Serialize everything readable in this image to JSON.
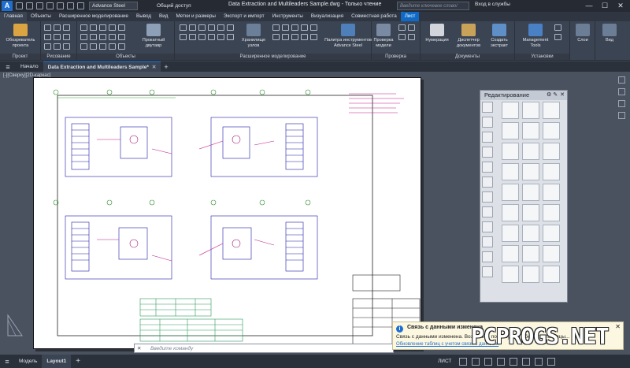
{
  "titlebar": {
    "app_letter": "A",
    "workspace": "Advance Steel",
    "share": "Общий доступ",
    "document_title": "Data Extraction and Multileaders Sample.dwg - Только чтение",
    "search_placeholder": "Введите ключевое слово/фразу",
    "login": "Вход в службы",
    "min": "—",
    "max": "☐",
    "close": "✕"
  },
  "ribbon_tabs": [
    "Главная",
    "Объекты",
    "Расширенное моделирование",
    "Вывод",
    "Вид",
    "Метки и размеры",
    "Экспорт и импорт",
    "Инструменты",
    "Визуализация",
    "Совместная работа",
    "Лист"
  ],
  "ribbon_active": "Лист",
  "ribbon": {
    "project_btn": "Обозреватель проекта",
    "project_panel": "Проект",
    "drawing_panel": "Рисование",
    "beam_btn": "Прокатный двутавр",
    "objects_panel": "Объекты",
    "storage_btn": "Хранилище узлов",
    "palette_btn": "Палитра инструментов Advance Steel",
    "advanced_panel": "Расширенное моделирование",
    "check_btn": "Проверка модели",
    "check_panel": "Проверка",
    "numbering_btn": "Нумерация",
    "doc_manager_btn": "Диспетчер документов",
    "extract_btn": "Создать экстракт",
    "docs_panel": "Документы",
    "mgmt_btn": "Management Tools",
    "settings_panel": "Установки",
    "layers_btn": "Слои",
    "view_btn": "Вид"
  },
  "filetabs": {
    "start": "Начало",
    "file": "Data Extraction and Multileaders Sample*"
  },
  "viewctl": "[-][Сверху][2D-каркас]",
  "palette": {
    "title": "Редактирование",
    "pin": "⚙ ✎",
    "close": "✕"
  },
  "notification": {
    "title": "Связь с данными изменена",
    "message": "Связь с данными изменена. Возможно, потребуется обновить таблицы...",
    "link": "Обновление таблиц с учетом связи с данными"
  },
  "cmdline": {
    "placeholder": "Введите команду",
    "close": "✕"
  },
  "statusbar": {
    "model": "Модель",
    "layout": "Layout1",
    "mode": "ЛИСТ"
  },
  "watermark": "PCPROGS.NET"
}
